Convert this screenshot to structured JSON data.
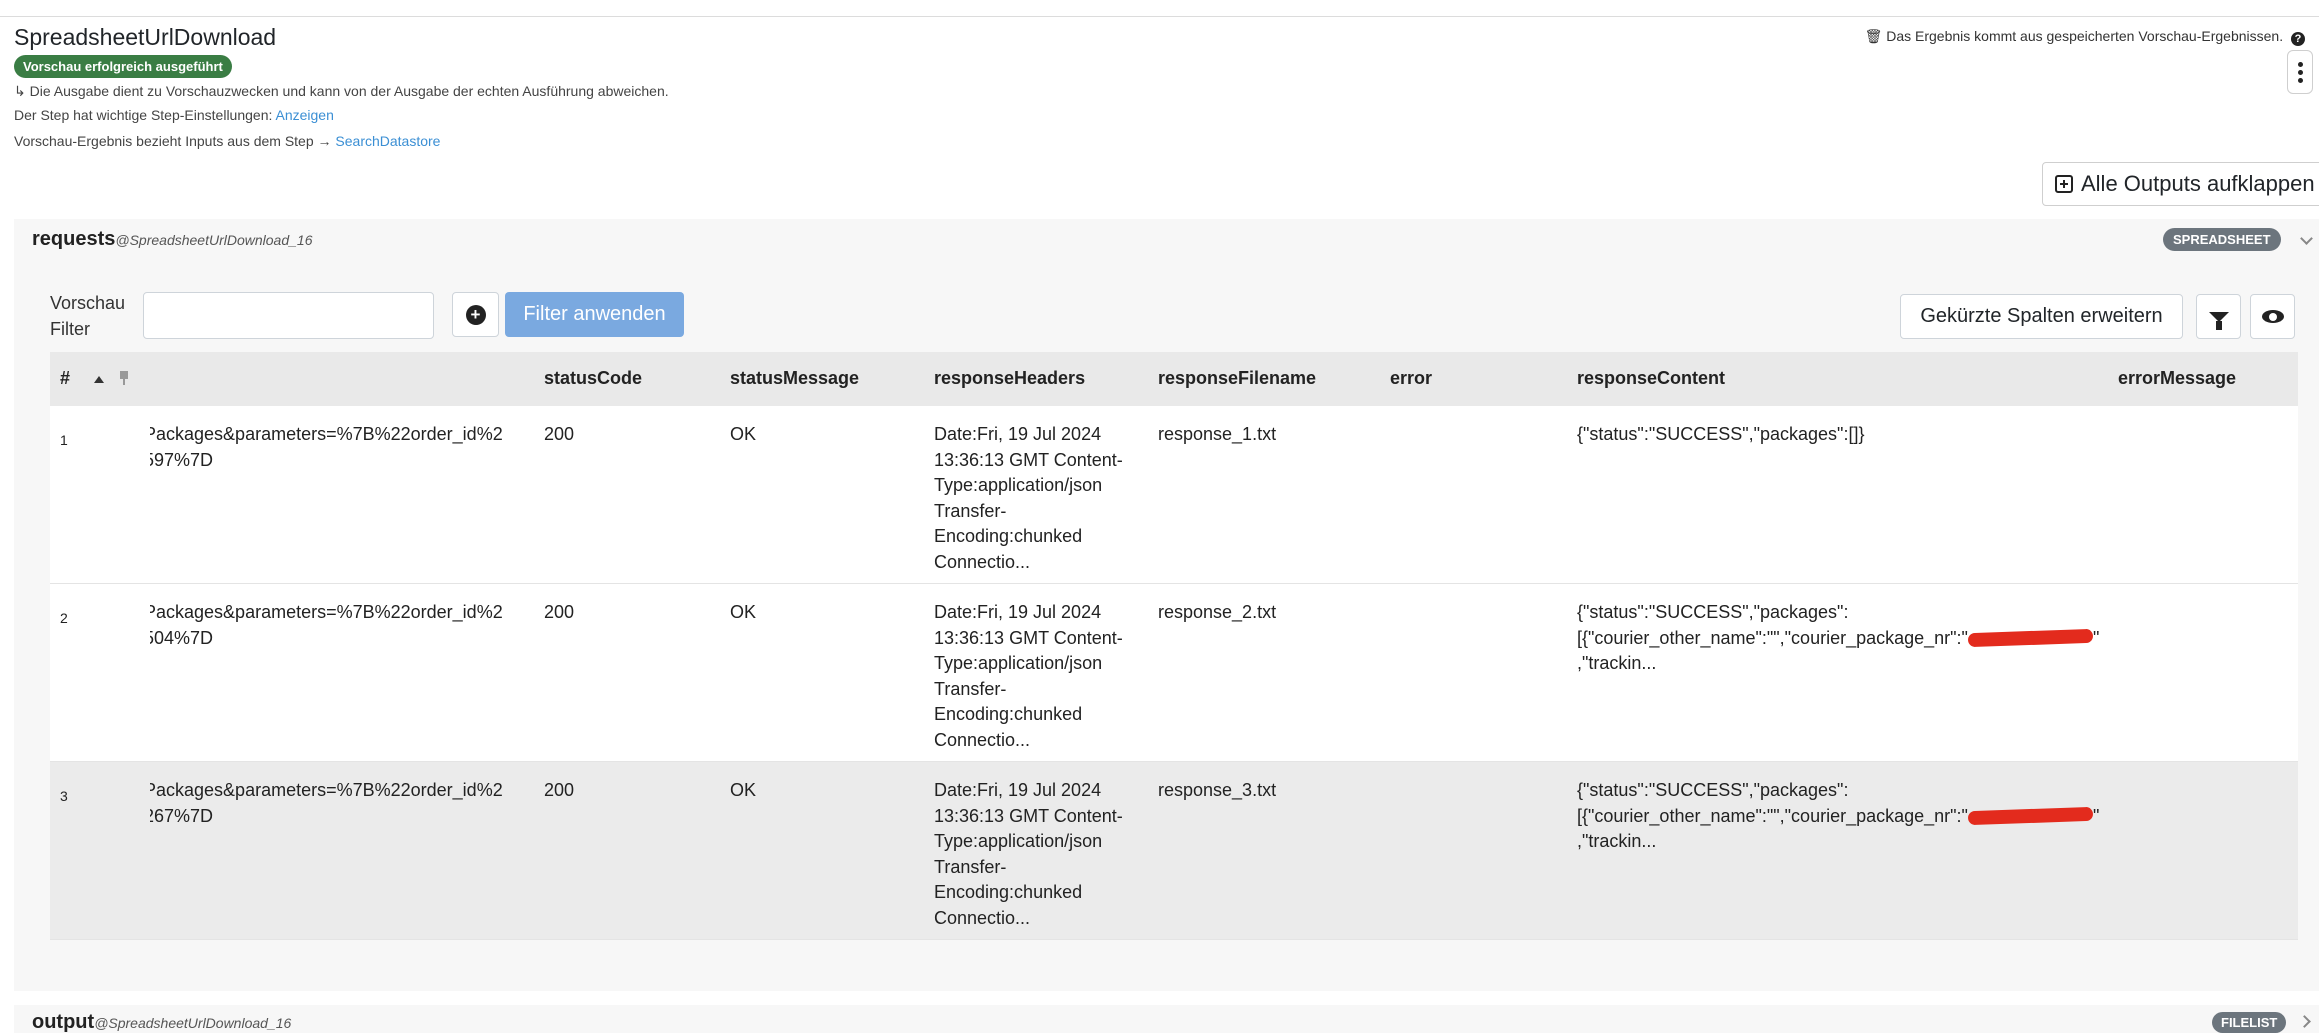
{
  "header": {
    "title": "SpreadsheetUrlDownload",
    "status_badge": "Vorschau erfolgreich ausgeführt",
    "preview_note": "↳ Die Ausgabe dient zu Vorschauzwecken und kann von der Ausgabe der echten Ausführung abweichen.",
    "settings_text": "Der Step hat wichtige Step-Einstellungen:",
    "settings_link": "Anzeigen",
    "inputs_text": "Vorschau-Ergebnis bezieht Inputs aus dem Step →",
    "inputs_link": "SearchDatastore",
    "saved_note": "🗑 Das Ergebnis kommt aus gespeicherten Vorschau-Ergebnissen.",
    "help_icon": "?"
  },
  "toolbar": {
    "expand_all_label": "Alle Outputs aufklappen"
  },
  "requests_panel": {
    "name": "requests",
    "source": "@SpreadsheetUrlDownload_16",
    "type_badge": "SPREADSHEET",
    "filter_label": "Vorschau Filter",
    "filter_value": "",
    "apply_label": "Filter anwenden",
    "expand_columns_label": "Gekürzte Spalten erweitern",
    "columns": [
      "#",
      "statusCode",
      "statusMessage",
      "responseHeaders",
      "responseFilename",
      "error",
      "responseContent",
      "errorMessage"
    ],
    "rows": [
      {
        "num": "1",
        "url_1": "Packages&parameters=%7B%22order_id%2",
        "url_2": "597%7D",
        "statusCode": "200",
        "statusMessage": "OK",
        "responseHeaders": "Date:Fri, 19 Jul 2024 13:36:13 GMT Content-Type:application/json Transfer-Encoding:chunked Connectio...",
        "responseFilename": "response_1.txt",
        "responseContent_1": "{\"status\":\"SUCCESS\",\"packages\":[]}",
        "responseContent_2": "",
        "responseContent_3": ""
      },
      {
        "num": "2",
        "url_1": "Packages&parameters=%7B%22order_id%2",
        "url_2": "504%7D",
        "statusCode": "200",
        "statusMessage": "OK",
        "responseHeaders": "Date:Fri, 19 Jul 2024 13:36:13 GMT Content-Type:application/json Transfer-Encoding:chunked Connectio...",
        "responseFilename": "response_2.txt",
        "responseContent_1": "{\"status\":\"SUCCESS\",\"packages\":",
        "responseContent_2": "[{\"courier_other_name\":\"\",\"courier_package_nr\":\"",
        "responseContent_3": ",\"trackin..."
      },
      {
        "num": "3",
        "url_1": "Packages&parameters=%7B%22order_id%2",
        "url_2": "267%7D",
        "statusCode": "200",
        "statusMessage": "OK",
        "responseHeaders": "Date:Fri, 19 Jul 2024 13:36:13 GMT Content-Type:application/json Transfer-Encoding:chunked Connectio...",
        "responseFilename": "response_3.txt",
        "responseContent_1": "{\"status\":\"SUCCESS\",\"packages\":",
        "responseContent_2": "[{\"courier_other_name\":\"\",\"courier_package_nr\":\"",
        "responseContent_3": ",\"trackin..."
      }
    ]
  },
  "output_panel": {
    "name": "output",
    "source": "@SpreadsheetUrlDownload_16",
    "type_badge": "FILELIST"
  },
  "colors": {
    "success": "#3a7d44",
    "link": "#3b8fd4",
    "apply_button": "#7aa9e0",
    "badge": "#6c757d",
    "redaction": "#e32b1d"
  }
}
